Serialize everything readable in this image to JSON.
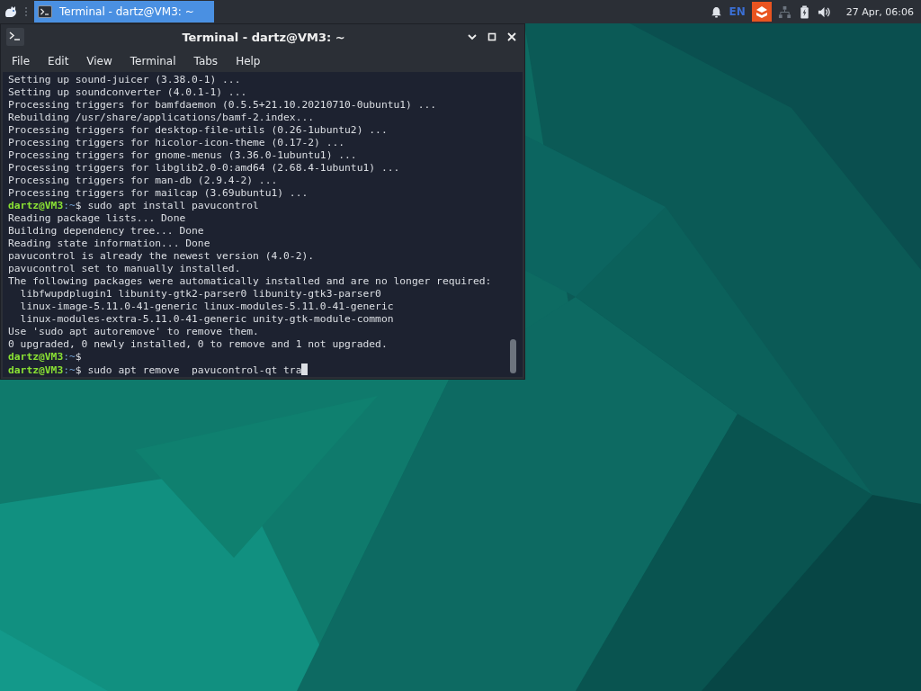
{
  "panel": {
    "tasks": [
      {
        "label": "Terminal - dartz@VM3: ~",
        "selected": true
      }
    ],
    "keyboard_layout": "EN",
    "clock": "27 Apr, 06:06"
  },
  "window": {
    "title": "Terminal - dartz@VM3: ~",
    "menu": [
      "File",
      "Edit",
      "View",
      "Terminal",
      "Tabs",
      "Help"
    ],
    "lines": [
      {
        "kind": "output",
        "text": "Setting up sound-juicer (3.38.0-1) ..."
      },
      {
        "kind": "output",
        "text": "Setting up soundconverter (4.0.1-1) ..."
      },
      {
        "kind": "output",
        "text": "Processing triggers for bamfdaemon (0.5.5+21.10.20210710-0ubuntu1) ..."
      },
      {
        "kind": "output",
        "text": "Rebuilding /usr/share/applications/bamf-2.index..."
      },
      {
        "kind": "output",
        "text": "Processing triggers for desktop-file-utils (0.26-1ubuntu2) ..."
      },
      {
        "kind": "output",
        "text": "Processing triggers for hicolor-icon-theme (0.17-2) ..."
      },
      {
        "kind": "output",
        "text": "Processing triggers for gnome-menus (3.36.0-1ubuntu1) ..."
      },
      {
        "kind": "output",
        "text": "Processing triggers for libglib2.0-0:amd64 (2.68.4-1ubuntu1) ..."
      },
      {
        "kind": "output",
        "text": "Processing triggers for man-db (2.9.4-2) ..."
      },
      {
        "kind": "output",
        "text": "Processing triggers for mailcap (3.69ubuntu1) ..."
      },
      {
        "kind": "prompt",
        "user": "dartz@VM3",
        "path": ":~",
        "command": "$ sudo apt install pavucontrol"
      },
      {
        "kind": "output",
        "text": "Reading package lists... Done"
      },
      {
        "kind": "output",
        "text": "Building dependency tree... Done"
      },
      {
        "kind": "output",
        "text": "Reading state information... Done"
      },
      {
        "kind": "output",
        "text": "pavucontrol is already the newest version (4.0-2)."
      },
      {
        "kind": "output",
        "text": "pavucontrol set to manually installed."
      },
      {
        "kind": "output",
        "text": "The following packages were automatically installed and are no longer required:"
      },
      {
        "kind": "output",
        "text": "  libfwupdplugin1 libunity-gtk2-parser0 libunity-gtk3-parser0"
      },
      {
        "kind": "output",
        "text": "  linux-image-5.11.0-41-generic linux-modules-5.11.0-41-generic"
      },
      {
        "kind": "output",
        "text": "  linux-modules-extra-5.11.0-41-generic unity-gtk-module-common"
      },
      {
        "kind": "output",
        "text": "Use 'sudo apt autoremove' to remove them."
      },
      {
        "kind": "output",
        "text": "0 upgraded, 0 newly installed, 0 to remove and 1 not upgraded."
      },
      {
        "kind": "prompt",
        "user": "dartz@VM3",
        "path": ":~",
        "command": "$"
      },
      {
        "kind": "prompt",
        "user": "dartz@VM3",
        "path": ":~",
        "command": "$ sudo apt remove  pavucontrol-qt tra",
        "cursor": true
      }
    ]
  }
}
